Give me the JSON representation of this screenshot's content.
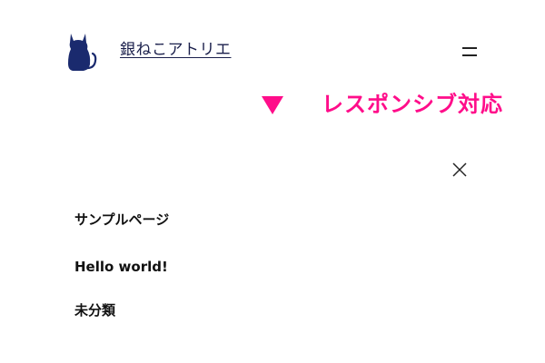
{
  "header": {
    "site_title": "銀ねこアトリエ",
    "logo_icon": "black-cat-icon",
    "menu_icon": "hamburger-menu-icon"
  },
  "annotation": {
    "text": "レスポンシブ対応",
    "icon": "down-triangle-icon",
    "color": "#ff0d8a"
  },
  "nav": {
    "close_icon": "close-icon",
    "items": [
      {
        "label": "サンプルページ"
      },
      {
        "label": "Hello world!"
      },
      {
        "label": "未分類"
      }
    ]
  }
}
